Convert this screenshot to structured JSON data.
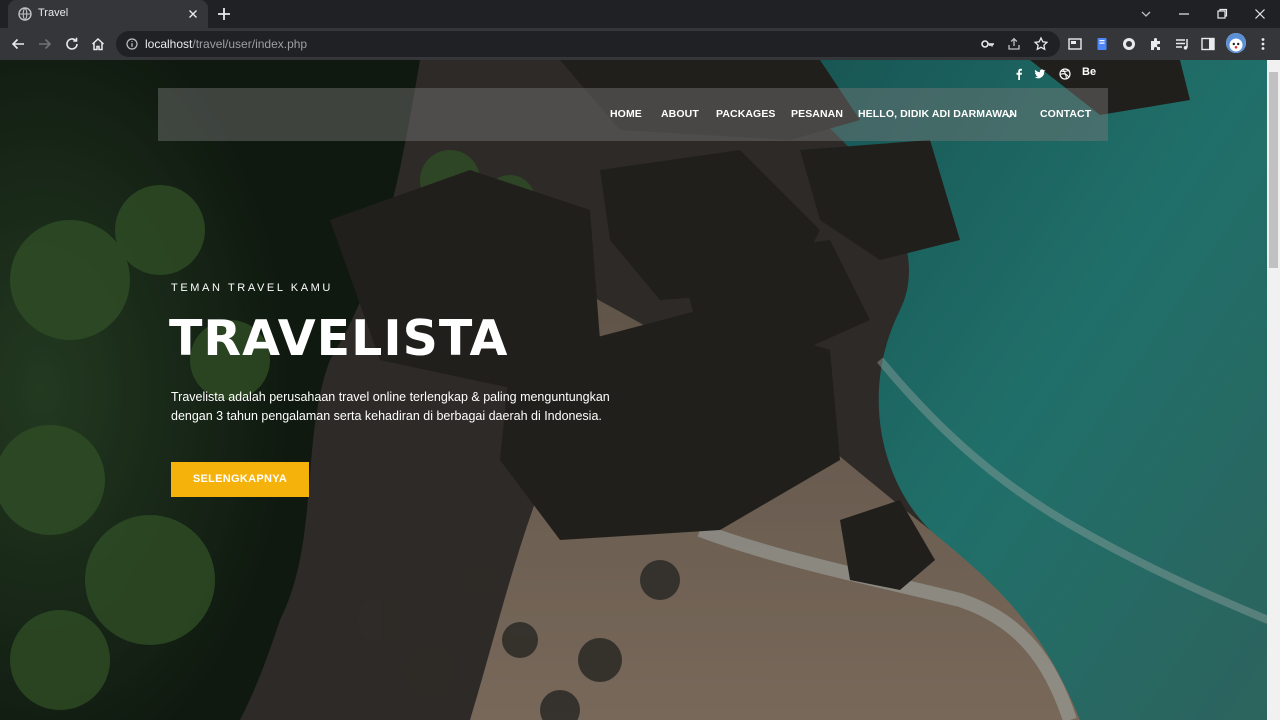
{
  "browser": {
    "tab_title": "Travel",
    "url_host": "localhost",
    "url_path": "/travel/user/index.php"
  },
  "navbar": {
    "items": [
      "HOME",
      "ABOUT",
      "PACKAGES",
      "PESANAN",
      "HELLO, DIDIK ADI DARMAWAN",
      "CONTACT"
    ]
  },
  "social": {
    "icons": [
      "facebook-icon",
      "twitter-icon",
      "dribbble-icon",
      "behance-icon"
    ],
    "behance_label": "Be"
  },
  "hero": {
    "eyebrow": "TEMAN TRAVEL KAMU",
    "title": "TRAVELISTA",
    "description": "Travelista adalah perusahaan travel online terlengkap & paling menguntungkan dengan 3 tahun pengalaman serta kehadiran di berbagai daerah di Indonesia.",
    "cta_label": "SELENGKAPNYA"
  },
  "colors": {
    "accent": "#f5b20b",
    "chrome_dark": "#202124",
    "chrome_mid": "#35363a",
    "sea": "#2f8f8a",
    "sand": "#8a7866",
    "forest": "#1f3020"
  }
}
